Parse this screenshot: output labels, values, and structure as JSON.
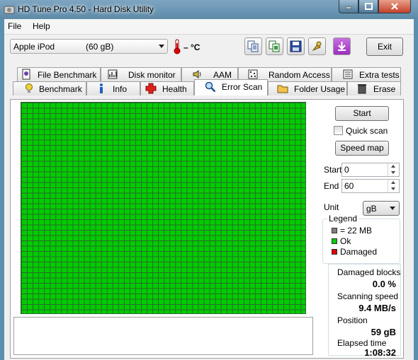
{
  "window": {
    "title": "HD Tune Pro 4.50 - Hard Disk Utility"
  },
  "menu": {
    "file": "File",
    "help": "Help"
  },
  "toolbar": {
    "drive_name": "Apple   iPod",
    "drive_capacity": "(60 gB)",
    "temperature": "– °C",
    "exit_label": "Exit",
    "icons": [
      "copy-text-icon",
      "copy-screenshot-icon",
      "save-icon",
      "options-icon",
      "download-icon"
    ]
  },
  "tabs": {
    "row1": [
      "File Benchmark",
      "Disk monitor",
      "AAM",
      "Random Access",
      "Extra tests"
    ],
    "row2": [
      "Benchmark",
      "Info",
      "Health",
      "Error Scan",
      "Folder Usage",
      "Erase"
    ],
    "active": "Error Scan"
  },
  "error_scan": {
    "start_button": "Start",
    "quick_scan_label": "Quick scan",
    "quick_scan_checked": false,
    "speed_map_button": "Speed map",
    "start_label": "Start",
    "start_value": "0",
    "end_label": "End",
    "end_value": "60",
    "unit_label": "Unit",
    "unit_value": "gB",
    "legend": {
      "title": "Legend",
      "block_size": "= 22 MB",
      "ok": "Ok",
      "damaged": "Damaged",
      "colors": {
        "block": "#808080",
        "ok": "#00cc00",
        "damaged": "#e00000"
      }
    },
    "stats": {
      "damaged_blocks_label": "Damaged blocks",
      "damaged_blocks_value": "0.0 %",
      "scanning_speed_label": "Scanning speed",
      "scanning_speed_value": "9.4 MB/s",
      "position_label": "Position",
      "position_value": "59 gB",
      "elapsed_label": "Elapsed time",
      "elapsed_value": "1:08:32"
    },
    "grid_color": "#00cc00"
  }
}
